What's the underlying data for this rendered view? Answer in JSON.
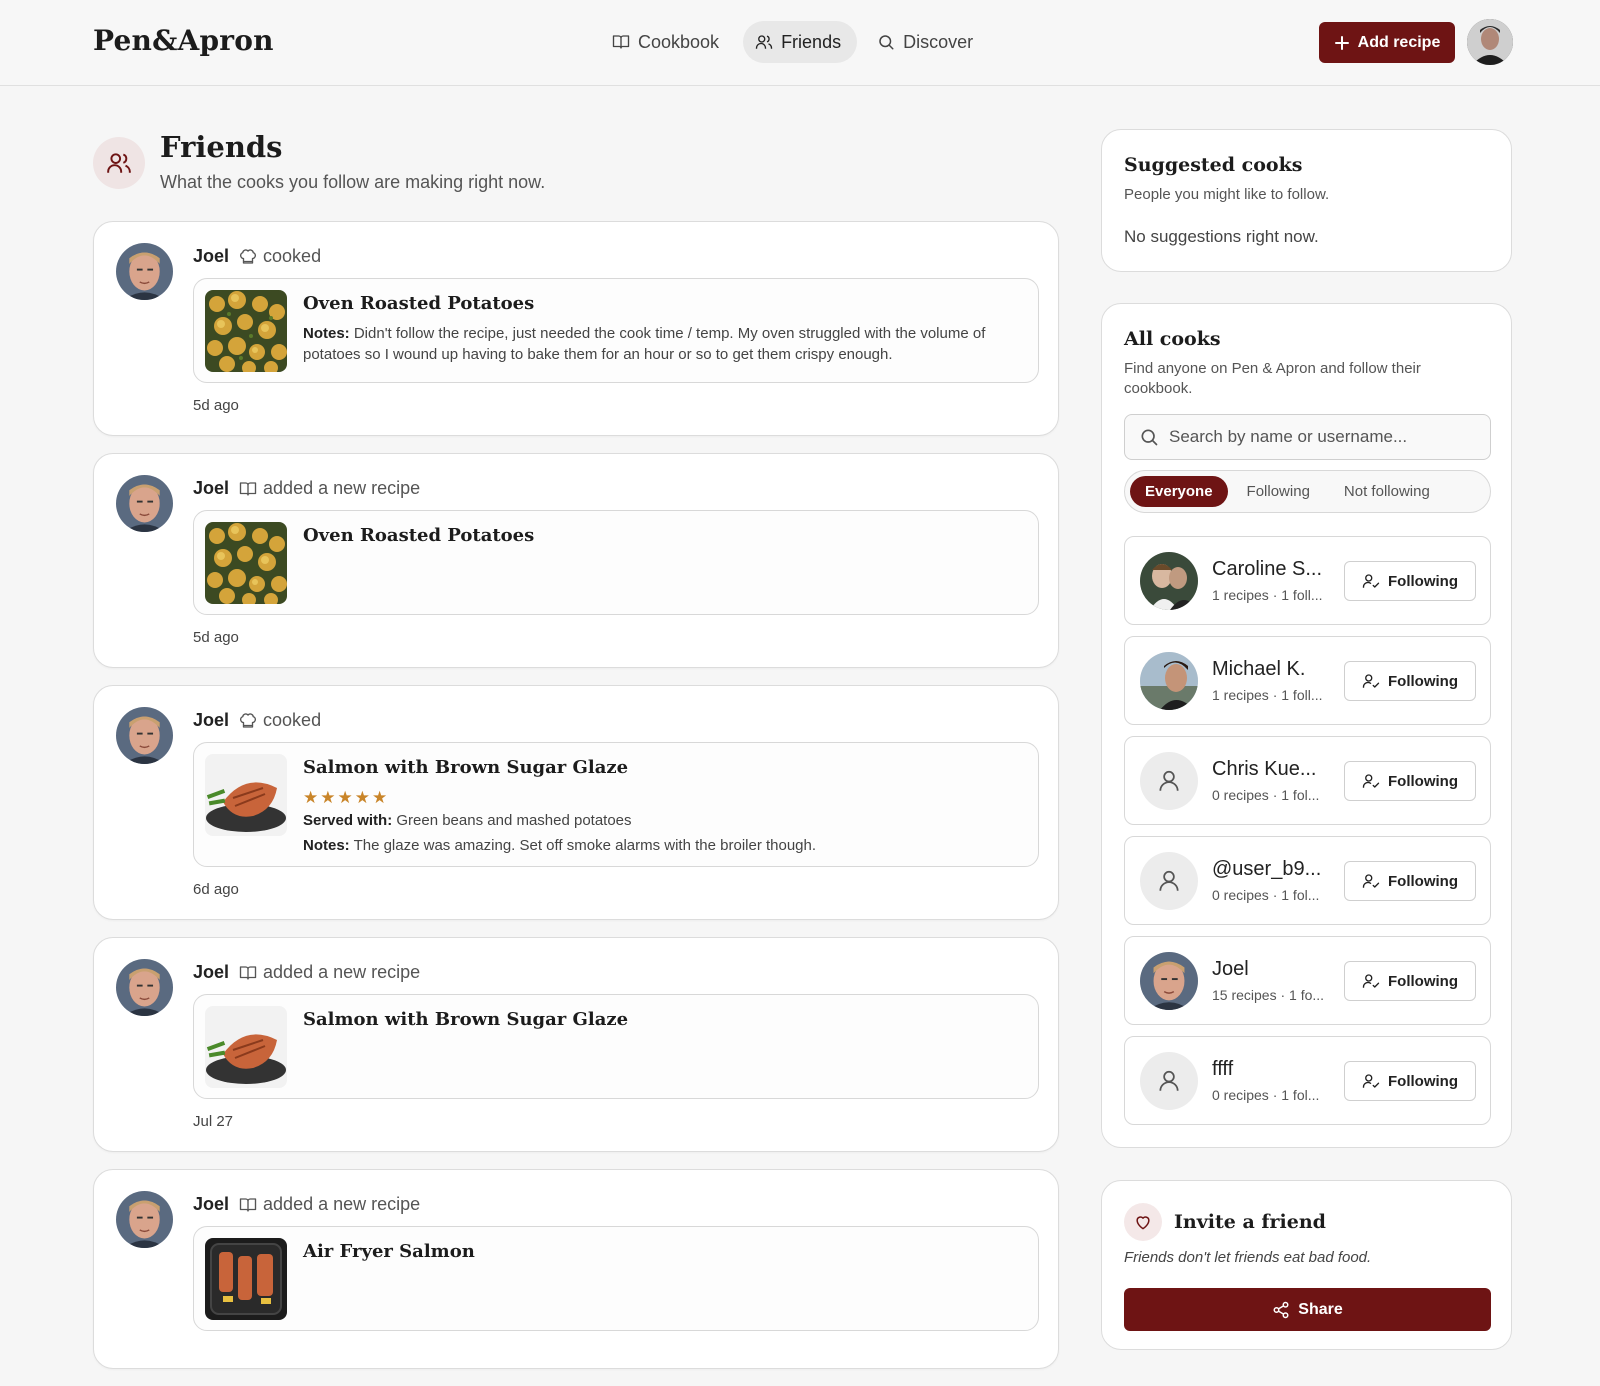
{
  "header": {
    "logo": "Pen&Apron",
    "nav": [
      {
        "label": "Cookbook",
        "icon": "book-icon"
      },
      {
        "label": "Friends",
        "icon": "users-icon",
        "active": true
      },
      {
        "label": "Discover",
        "icon": "search-icon"
      }
    ],
    "add_recipe": "Add recipe"
  },
  "page": {
    "title": "Friends",
    "subtitle": "What the cooks you follow are making right now."
  },
  "feed": [
    {
      "user": "Joel",
      "action": "cooked",
      "action_icon": "chef-hat-icon",
      "recipe": "Oven Roasted Potatoes",
      "notes_label": "Notes:",
      "notes": "Didn't follow the recipe, just needed the cook time / temp. My oven struggled with the volume of potatoes so I wound up having to bake them for an hour or so to get them crispy enough.",
      "time": "5d ago"
    },
    {
      "user": "Joel",
      "action": "added a new recipe",
      "action_icon": "book-icon",
      "recipe": "Oven Roasted Potatoes",
      "time": "5d ago"
    },
    {
      "user": "Joel",
      "action": "cooked",
      "action_icon": "chef-hat-icon",
      "recipe": "Salmon with Brown Sugar Glaze",
      "rating": 5,
      "served_label": "Served with:",
      "served": "Green beans and mashed potatoes",
      "notes_label": "Notes:",
      "notes": "The glaze was amazing. Set off smoke alarms with the broiler though.",
      "time": "6d ago"
    },
    {
      "user": "Joel",
      "action": "added a new recipe",
      "action_icon": "book-icon",
      "recipe": "Salmon with Brown Sugar Glaze",
      "time": "Jul 27"
    },
    {
      "user": "Joel",
      "action": "added a new recipe",
      "action_icon": "book-icon",
      "recipe": "Air Fryer Salmon"
    }
  ],
  "suggested": {
    "title": "Suggested cooks",
    "subtitle": "People you might like to follow.",
    "empty": "No suggestions right now."
  },
  "all_cooks": {
    "title": "All cooks",
    "subtitle": "Find anyone on Pen & Apron and follow their cookbook.",
    "search_placeholder": "Search by name or username...",
    "filters": [
      "Everyone",
      "Following",
      "Not following"
    ],
    "active_filter": "Everyone",
    "follow_label": "Following",
    "cooks": [
      {
        "name": "Caroline S...",
        "meta": "1 recipes · 1 foll..."
      },
      {
        "name": "Michael K.",
        "meta": "1 recipes · 1 foll..."
      },
      {
        "name": "Chris Kue...",
        "meta": "0 recipes · 1 fol..."
      },
      {
        "name": "@user_b9...",
        "meta": "0 recipes · 1 fol..."
      },
      {
        "name": "Joel",
        "meta": "15 recipes · 1 fo..."
      },
      {
        "name": "ffff",
        "meta": "0 recipes · 1 fol..."
      }
    ]
  },
  "invite": {
    "title": "Invite a friend",
    "subtitle": "Friends don't let friends eat bad food.",
    "share": "Share"
  },
  "colors": {
    "accent": "#6e1414",
    "star": "#c98529",
    "background": "#f6f6f6"
  }
}
